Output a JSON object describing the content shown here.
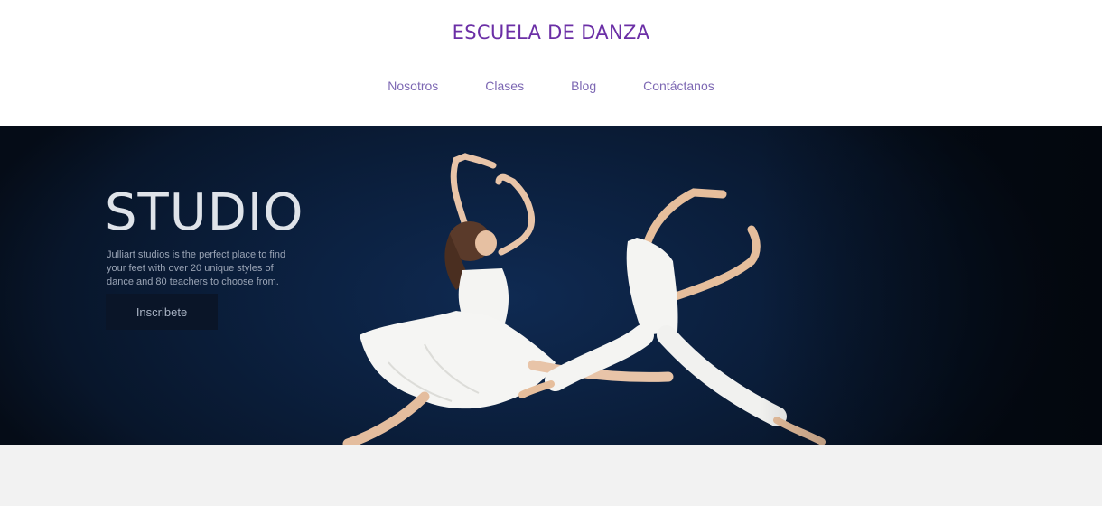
{
  "header": {
    "brand": "ESCUELA DE DANZA",
    "nav": [
      "Nosotros",
      "Clases",
      "Blog",
      "Contáctanos"
    ]
  },
  "hero": {
    "title": "STUDIO",
    "description": "Julliart studios is the perfect place to find your feet with over 20 unique styles of dance and 80 teachers to choose from.",
    "button_label": "Inscribete",
    "image": "two-dancers-photo"
  },
  "colors": {
    "brand": "#6b2fa6",
    "nav": "#7d68b3",
    "hero_background": "#0b1f3d",
    "footer_band": "#f2f2f2"
  }
}
